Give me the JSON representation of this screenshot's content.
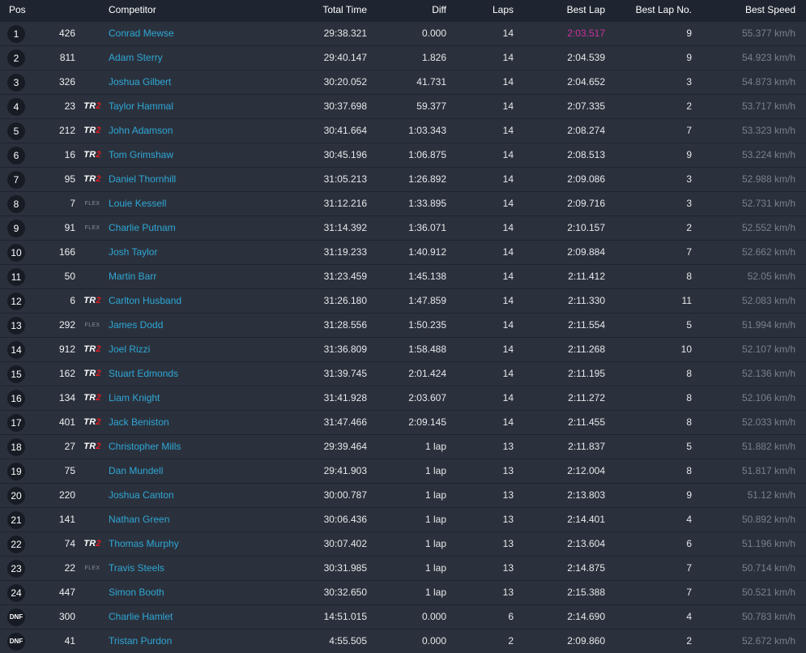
{
  "headers": {
    "pos": "Pos",
    "competitor": "Competitor",
    "total_time": "Total Time",
    "diff": "Diff",
    "laps": "Laps",
    "best_lap": "Best Lap",
    "best_lap_no": "Best Lap No.",
    "best_speed": "Best Speed"
  },
  "colors": {
    "link": "#2ea7d6",
    "fastest_lap": "#c9319e",
    "tr2_accent": "#e11b22"
  },
  "rows": [
    {
      "pos": "1",
      "num": "426",
      "class": "",
      "name": "Conrad Mewse",
      "total": "29:38.321",
      "diff": "0.000",
      "laps": "14",
      "best": "2:03.517",
      "best_no": "9",
      "speed": "55.377 km/h",
      "fastest": true
    },
    {
      "pos": "2",
      "num": "811",
      "class": "",
      "name": "Adam Sterry",
      "total": "29:40.147",
      "diff": "1.826",
      "laps": "14",
      "best": "2:04.539",
      "best_no": "9",
      "speed": "54.923 km/h"
    },
    {
      "pos": "3",
      "num": "326",
      "class": "",
      "name": "Joshua Gilbert",
      "total": "30:20.052",
      "diff": "41.731",
      "laps": "14",
      "best": "2:04.652",
      "best_no": "3",
      "speed": "54.873 km/h"
    },
    {
      "pos": "4",
      "num": "23",
      "class": "TR2",
      "name": "Taylor Hammal",
      "total": "30:37.698",
      "diff": "59.377",
      "laps": "14",
      "best": "2:07.335",
      "best_no": "2",
      "speed": "53.717 km/h"
    },
    {
      "pos": "5",
      "num": "212",
      "class": "TR2",
      "name": "John Adamson",
      "total": "30:41.664",
      "diff": "1:03.343",
      "laps": "14",
      "best": "2:08.274",
      "best_no": "7",
      "speed": "53.323 km/h"
    },
    {
      "pos": "6",
      "num": "16",
      "class": "TR2",
      "name": "Tom Grimshaw",
      "total": "30:45.196",
      "diff": "1:06.875",
      "laps": "14",
      "best": "2:08.513",
      "best_no": "9",
      "speed": "53.224 km/h"
    },
    {
      "pos": "7",
      "num": "95",
      "class": "TR2",
      "name": "Daniel Thornhill",
      "total": "31:05.213",
      "diff": "1:26.892",
      "laps": "14",
      "best": "2:09.086",
      "best_no": "3",
      "speed": "52.988 km/h"
    },
    {
      "pos": "8",
      "num": "7",
      "class": "FLEX",
      "name": "Louie Kessell",
      "total": "31:12.216",
      "diff": "1:33.895",
      "laps": "14",
      "best": "2:09.716",
      "best_no": "3",
      "speed": "52.731 km/h"
    },
    {
      "pos": "9",
      "num": "91",
      "class": "FLEX",
      "name": "Charlie Putnam",
      "total": "31:14.392",
      "diff": "1:36.071",
      "laps": "14",
      "best": "2:10.157",
      "best_no": "2",
      "speed": "52.552 km/h"
    },
    {
      "pos": "10",
      "num": "166",
      "class": "",
      "name": "Josh Taylor",
      "total": "31:19.233",
      "diff": "1:40.912",
      "laps": "14",
      "best": "2:09.884",
      "best_no": "7",
      "speed": "52.662 km/h"
    },
    {
      "pos": "11",
      "num": "50",
      "class": "",
      "name": "Martin Barr",
      "total": "31:23.459",
      "diff": "1:45.138",
      "laps": "14",
      "best": "2:11.412",
      "best_no": "8",
      "speed": "52.05 km/h"
    },
    {
      "pos": "12",
      "num": "6",
      "class": "TR2",
      "name": "Carlton Husband",
      "total": "31:26.180",
      "diff": "1:47.859",
      "laps": "14",
      "best": "2:11.330",
      "best_no": "11",
      "speed": "52.083 km/h"
    },
    {
      "pos": "13",
      "num": "292",
      "class": "FLEX",
      "name": "James Dodd",
      "total": "31:28.556",
      "diff": "1:50.235",
      "laps": "14",
      "best": "2:11.554",
      "best_no": "5",
      "speed": "51.994 km/h"
    },
    {
      "pos": "14",
      "num": "912",
      "class": "TR2",
      "name": "Joel Rizzi",
      "total": "31:36.809",
      "diff": "1:58.488",
      "laps": "14",
      "best": "2:11.268",
      "best_no": "10",
      "speed": "52.107 km/h"
    },
    {
      "pos": "15",
      "num": "162",
      "class": "TR2",
      "name": "Stuart Edmonds",
      "total": "31:39.745",
      "diff": "2:01.424",
      "laps": "14",
      "best": "2:11.195",
      "best_no": "8",
      "speed": "52.136 km/h"
    },
    {
      "pos": "16",
      "num": "134",
      "class": "TR2",
      "name": "Liam Knight",
      "total": "31:41.928",
      "diff": "2:03.607",
      "laps": "14",
      "best": "2:11.272",
      "best_no": "8",
      "speed": "52.106 km/h"
    },
    {
      "pos": "17",
      "num": "401",
      "class": "TR2",
      "name": "Jack Beniston",
      "total": "31:47.466",
      "diff": "2:09.145",
      "laps": "14",
      "best": "2:11.455",
      "best_no": "8",
      "speed": "52.033 km/h"
    },
    {
      "pos": "18",
      "num": "27",
      "class": "TR2",
      "name": "Christopher Mills",
      "total": "29:39.464",
      "diff": "1 lap",
      "laps": "13",
      "best": "2:11.837",
      "best_no": "5",
      "speed": "51.882 km/h"
    },
    {
      "pos": "19",
      "num": "75",
      "class": "",
      "name": "Dan Mundell",
      "total": "29:41.903",
      "diff": "1 lap",
      "laps": "13",
      "best": "2:12.004",
      "best_no": "8",
      "speed": "51.817 km/h"
    },
    {
      "pos": "20",
      "num": "220",
      "class": "",
      "name": "Joshua Canton",
      "total": "30:00.787",
      "diff": "1 lap",
      "laps": "13",
      "best": "2:13.803",
      "best_no": "9",
      "speed": "51.12 km/h"
    },
    {
      "pos": "21",
      "num": "141",
      "class": "",
      "name": "Nathan Green",
      "total": "30:06.436",
      "diff": "1 lap",
      "laps": "13",
      "best": "2:14.401",
      "best_no": "4",
      "speed": "50.892 km/h"
    },
    {
      "pos": "22",
      "num": "74",
      "class": "TR2",
      "name": "Thomas Murphy",
      "total": "30:07.402",
      "diff": "1 lap",
      "laps": "13",
      "best": "2:13.604",
      "best_no": "6",
      "speed": "51.196 km/h"
    },
    {
      "pos": "23",
      "num": "22",
      "class": "FLEX",
      "name": "Travis Steels",
      "total": "30:31.985",
      "diff": "1 lap",
      "laps": "13",
      "best": "2:14.875",
      "best_no": "7",
      "speed": "50.714 km/h"
    },
    {
      "pos": "24",
      "num": "447",
      "class": "",
      "name": "Simon Booth",
      "total": "30:32.650",
      "diff": "1 lap",
      "laps": "13",
      "best": "2:15.388",
      "best_no": "7",
      "speed": "50.521 km/h"
    },
    {
      "pos": "DNF",
      "num": "300",
      "class": "",
      "name": "Charlie Hamlet",
      "total": "14:51.015",
      "diff": "0.000",
      "laps": "6",
      "best": "2:14.690",
      "best_no": "4",
      "speed": "50.783 km/h"
    },
    {
      "pos": "DNF",
      "num": "41",
      "class": "",
      "name": "Tristan Purdon",
      "total": "4:55.505",
      "diff": "0.000",
      "laps": "2",
      "best": "2:09.860",
      "best_no": "2",
      "speed": "52.672 km/h"
    }
  ]
}
